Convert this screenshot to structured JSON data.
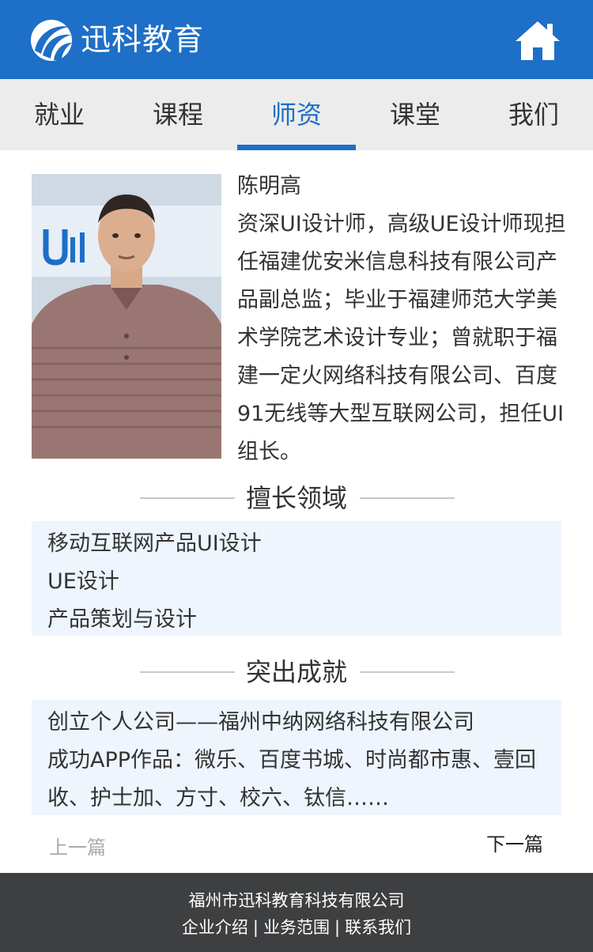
{
  "colors": {
    "brand": "#1d6fc7",
    "tab_bar": "#ececec",
    "box_bg": "#eef5fd",
    "footer_bg": "#3e3f41"
  },
  "header": {
    "brand": "迅科教育",
    "logo_icon": "swoosh-logo-icon",
    "home_icon": "home-icon"
  },
  "tabs": [
    {
      "label": "就业",
      "active": false
    },
    {
      "label": "课程",
      "active": false
    },
    {
      "label": "师资",
      "active": true
    },
    {
      "label": "课堂",
      "active": false
    },
    {
      "label": "我们",
      "active": false
    }
  ],
  "teacher": {
    "name": "陈明高",
    "bio": "资深UI设计师，高级UE设计师现担任福建优安米信息科技有限公司产品副总监；毕业于福建师范大学美术学院艺术设计专业；曾就职于福建一定火网络科技有限公司、百度91无线等大型互联网公司，担任UI组长。"
  },
  "expertise": {
    "title": "擅长领域",
    "items": [
      "移动互联网产品UI设计",
      "UE设计",
      "产品策划与设计"
    ]
  },
  "achievements": {
    "title": "突出成就",
    "items": [
      "创立个人公司——福州中纳网络科技有限公司",
      "成功APP作品：微乐、百度书城、时尚都市惠、壹回收、护士加、方寸、校六、钛信……"
    ]
  },
  "pager": {
    "prev": "上一篇",
    "next": "下一篇"
  },
  "footer": {
    "company": "福州市迅科教育科技有限公司",
    "links": [
      "企业介绍",
      "业务范围",
      "联系我们"
    ],
    "separator": "|"
  }
}
